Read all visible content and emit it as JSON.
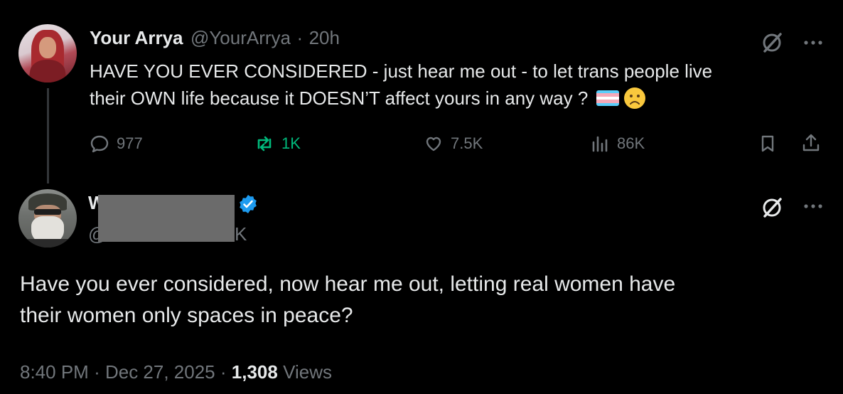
{
  "original_post": {
    "display_name": "Your Arrya",
    "handle": "@YourArrya",
    "separator": "·",
    "time": "20h",
    "text_line1": "HAVE YOU EVER CONSIDERED - just hear me out - to let trans people live",
    "text_line2": "their OWN life because it DOESN’T affect yours in any way ?",
    "emojis": [
      "trans-flag",
      "frowning-face"
    ],
    "actions": {
      "replies": "977",
      "reposts": "1K",
      "likes": "7.5K",
      "views": "86K"
    }
  },
  "reply_post": {
    "display_name_visible": "W",
    "handle_visible_start": "@",
    "handle_visible_end": "K",
    "verified": true,
    "text_line1": "Have you ever considered, now hear me out, letting real women have",
    "text_line2": "their women only spaces in peace?",
    "footer": {
      "time": "8:40 PM",
      "sep1": "·",
      "date": "Dec 27, 2025",
      "sep2": "·",
      "views_count": "1,308",
      "views_label": "Views"
    }
  },
  "colors": {
    "background": "#000000",
    "text": "#e7e9ea",
    "muted": "#71767b",
    "repost_active": "#00ba7c",
    "verified": "#1d9bf0"
  },
  "icons": [
    "grok-icon",
    "more-icon",
    "reply-icon",
    "repost-icon",
    "like-icon",
    "views-icon",
    "bookmark-icon",
    "share-icon",
    "verified-badge-icon"
  ]
}
